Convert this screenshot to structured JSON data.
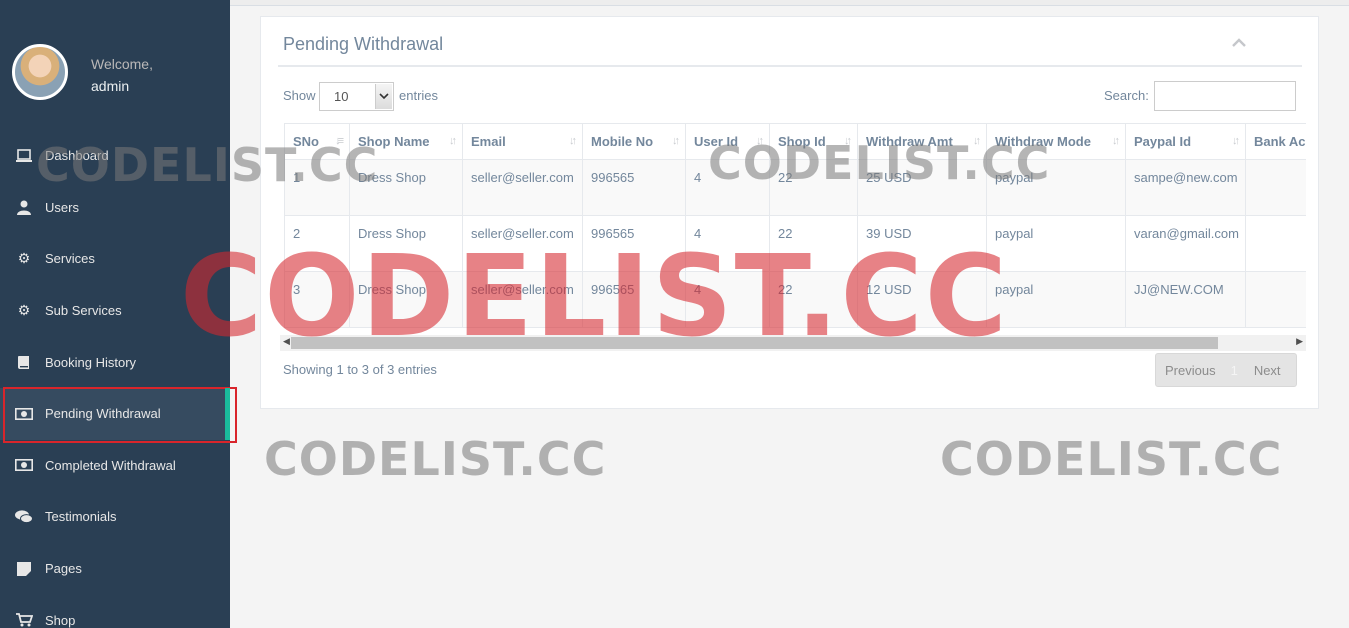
{
  "sidebar": {
    "welcome": "Welcome,",
    "username": "admin",
    "items": [
      {
        "label": "Dashboard",
        "icon": "laptop-icon"
      },
      {
        "label": "Users",
        "icon": "user-icon"
      },
      {
        "label": "Services",
        "icon": "gear-icon"
      },
      {
        "label": "Sub Services",
        "icon": "gear-icon"
      },
      {
        "label": "Booking History",
        "icon": "book-icon"
      },
      {
        "label": "Pending Withdrawal",
        "icon": "money-icon",
        "active": true
      },
      {
        "label": "Completed Withdrawal",
        "icon": "money-icon"
      },
      {
        "label": "Testimonials",
        "icon": "comments-icon"
      },
      {
        "label": "Pages",
        "icon": "page-icon"
      },
      {
        "label": "Shop",
        "icon": "cart-icon"
      }
    ]
  },
  "panel": {
    "title": "Pending Withdrawal",
    "show_label": "Show",
    "page_length": "10",
    "entries_label": "entries",
    "search_label": "Search:",
    "search_value": ""
  },
  "table": {
    "columns": [
      "SNo",
      "Shop Name",
      "Email",
      "Mobile No",
      "User Id",
      "Shop Id",
      "Withdraw Amt",
      "Withdraw Mode",
      "Paypal Id",
      "Bank Account"
    ],
    "rows": [
      [
        "1",
        "Dress Shop",
        "seller@seller.com",
        "996565",
        "4",
        "22",
        "25 USD",
        "paypal",
        "sampe@new.com",
        ""
      ],
      [
        "2",
        "Dress Shop",
        "seller@seller.com",
        "996565",
        "4",
        "22",
        "39 USD",
        "paypal",
        "varan@gmail.com",
        ""
      ],
      [
        "3",
        "Dress Shop",
        "seller@seller.com",
        "996565",
        "4",
        "22",
        "12 USD",
        "paypal",
        "JJ@NEW.COM",
        ""
      ]
    ]
  },
  "footer": {
    "info": "Showing 1 to 3 of 3 entries",
    "previous": "Previous",
    "current_page": "1",
    "next": "Next"
  },
  "watermark": "CODELIST.CC",
  "colors": {
    "sidebar": "#2a3f54",
    "accent": "#1abb9c",
    "highlight": "#d9252b"
  }
}
